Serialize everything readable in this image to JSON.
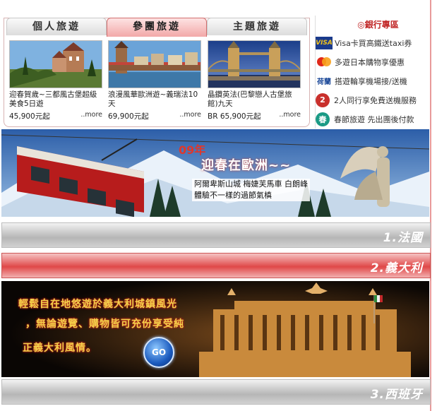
{
  "tabs": [
    {
      "label": "個人旅遊",
      "active": false
    },
    {
      "label": "參團旅遊",
      "active": true
    },
    {
      "label": "主題旅遊",
      "active": false
    }
  ],
  "tours": [
    {
      "title": "迎春賀歲~三都風古堡超級美食5日遊",
      "price": "45,900元起",
      "more": "..more"
    },
    {
      "title": "浪漫風華歐洲遊~義瑞法10天",
      "price": "69,900元起",
      "more": "..more"
    },
    {
      "title": "晶鑽英法(巴黎戀人古堡旅館)九天",
      "price": "BR 65,900元起",
      "more": "..more"
    }
  ],
  "bank": {
    "title": "◎銀行專區",
    "items": [
      {
        "logo": "VISA",
        "text": "Visa卡買高鐵送taxi券"
      },
      {
        "logo": "",
        "text": "多遊日本購物享優惠"
      },
      {
        "logo": "荷蘭",
        "text": "搭遊輪享機場接/送機"
      },
      {
        "logo": "2",
        "text": "2人同行享免費送機服務"
      },
      {
        "logo": "春",
        "text": "春節旅遊 先出團後付款"
      }
    ]
  },
  "promo": {
    "title_line1": "09年",
    "title_line2": "迎春在歐洲~~",
    "sub_line1": "阿爾卑斯山城 梅婕芙馬車 白朗峰",
    "sub_line2": "體驗不一樣的過節氣槙"
  },
  "countries": [
    {
      "label": "1.法國",
      "active": false
    },
    {
      "label": "2.義大利",
      "active": true
    },
    {
      "label": "3.西班牙",
      "active": false
    }
  ],
  "italy": {
    "line1": "輕鬆自在地悠遊於義大利城鎮風光",
    "line2": "，無論遊覽、購物皆可充份享受純",
    "line3": "正義大利風情。",
    "go": "GO"
  }
}
